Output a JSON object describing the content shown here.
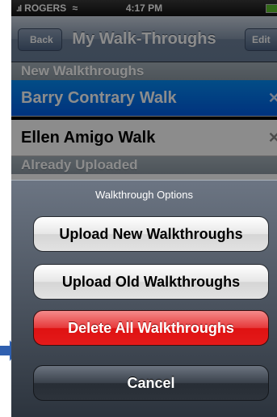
{
  "status_bar": {
    "signal": ".ıl",
    "carrier": "ROGERS",
    "wifi": "≈",
    "time": "4:17 PM"
  },
  "nav": {
    "back_label": "Back",
    "title": "My Walk-Throughs",
    "edit_label": "Edit"
  },
  "sections": [
    {
      "header": "New Walkthroughs",
      "rows": [
        {
          "label": "Barry Contrary Walk",
          "selected": true
        },
        {
          "label": "Ellen Amigo Walk",
          "selected": false
        }
      ]
    },
    {
      "header": "Already Uploaded",
      "rows": []
    }
  ],
  "delete_glyph": "✕",
  "action_sheet": {
    "title": "Walkthrough Options",
    "buttons": [
      {
        "label": "Upload New Walkthroughs",
        "style": "default"
      },
      {
        "label": "Upload Old Walkthroughs",
        "style": "default"
      },
      {
        "label": "Delete All Walkthroughs",
        "style": "destructive"
      },
      {
        "label": "Cancel",
        "style": "cancel"
      }
    ]
  },
  "colors": {
    "selected_row": "#0264e8",
    "destructive": "#e01616",
    "arrow": "#2f60b0"
  }
}
